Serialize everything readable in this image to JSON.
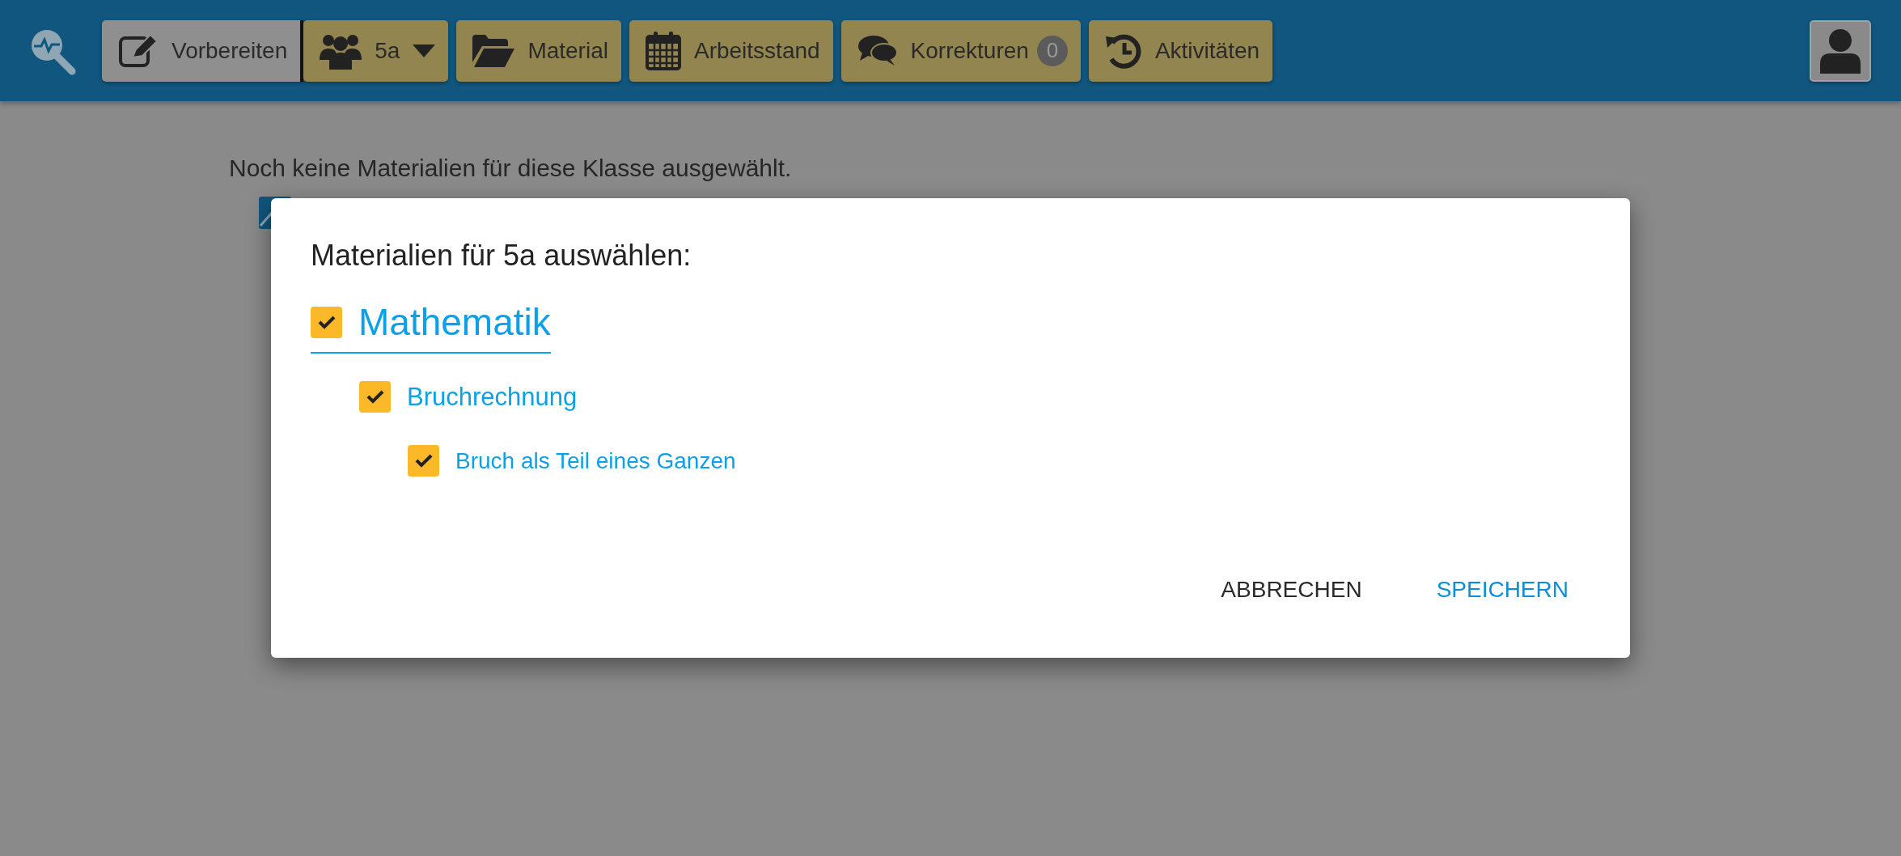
{
  "header": {
    "nav": [
      {
        "kind": "plain",
        "label": "Vorbereiten",
        "selected": true
      },
      {
        "kind": "dropdown",
        "label": "5a",
        "selected": false
      },
      {
        "kind": "plain",
        "label": "Material",
        "selected": false
      },
      {
        "kind": "plain",
        "label": "Arbeitsstand",
        "selected": false
      },
      {
        "kind": "badge",
        "label": "Korrekturen",
        "badge": "0",
        "selected": false
      },
      {
        "kind": "plain",
        "label": "Aktivitäten",
        "selected": false
      }
    ]
  },
  "page": {
    "message": "Noch keine Materialien für diese Klasse ausgewählt."
  },
  "dialog": {
    "title": "Materialien für 5a auswählen:",
    "tree": [
      {
        "label": "Mathematik",
        "checked": true,
        "children": [
          {
            "label": "Bruchrechnung",
            "checked": true,
            "children": [
              {
                "label": "Bruch als Teil eines Ganzen",
                "checked": true
              }
            ]
          }
        ]
      }
    ],
    "buttons": [
      {
        "kind": "secondary",
        "label": "ABBRECHEN"
      },
      {
        "kind": "primary",
        "label": "SPEICHERN"
      }
    ]
  }
}
